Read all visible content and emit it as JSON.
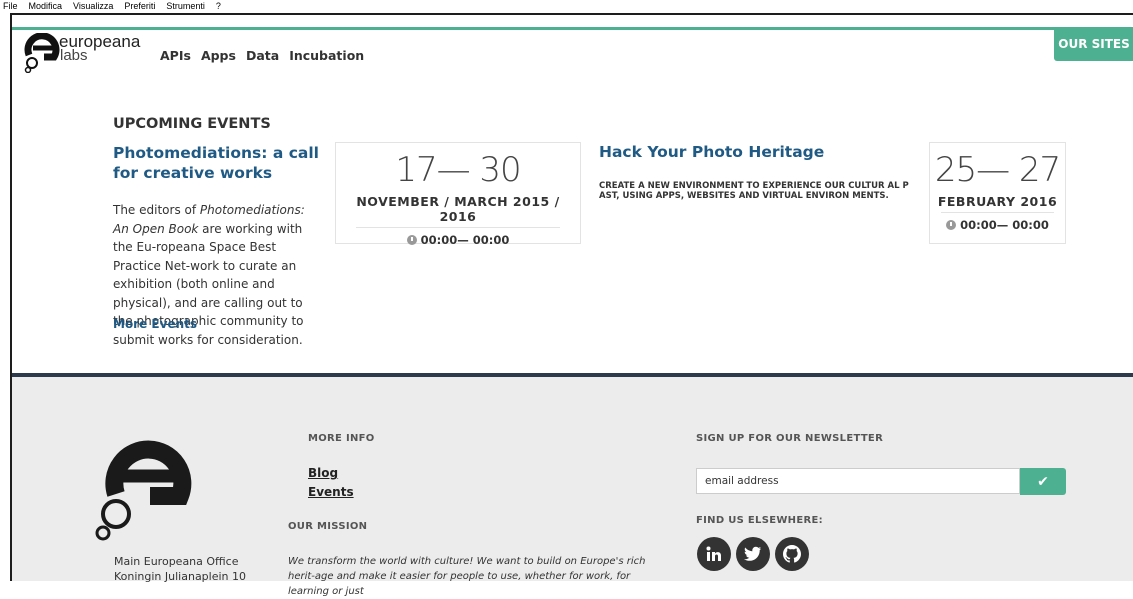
{
  "menubar": [
    "File",
    "Modifica",
    "Visualizza",
    "Preferiti",
    "Strumenti",
    "?"
  ],
  "header": {
    "brand_line1": "europeana",
    "brand_line2": "labs",
    "nav": [
      "APIs",
      "Apps",
      "Data",
      "Incubation"
    ],
    "our_sites": "OUR SITES"
  },
  "events": {
    "section_title": "UPCOMING EVENTS",
    "event1": {
      "title": "Photomediations: a call for creative works",
      "body_prefix": "The editors of ",
      "body_italic": "Photomediations: An Open Book",
      "body_rest": " are working with the Eu-ropeana Space Best Practice Net-work to curate an exhibition (both online and physical), and are calling out to the photographic community to submit works for consideration.",
      "date_range": "17— 30",
      "months": "NOVEMBER / MARCH 2015 / 2016",
      "time": "00:00— 00:00"
    },
    "event2": {
      "title": "Hack Your Photo Heritage",
      "description": "CREATE A NEW ENVIRONMENT TO EXPERIENCE OUR CULTUR AL PAST, USING APPS, WEBSITES AND VIRTUAL ENVIRON MENTS.",
      "date_range": "25— 27",
      "months": "FEBRUARY 2016",
      "time": "00:00— 00:00"
    },
    "more_events": "More Events"
  },
  "footer": {
    "office_line1": "Main Europeana Office",
    "office_line2": "Koningin Julianaplein 10",
    "more_info_heading": "MORE INFO",
    "links": [
      "Blog",
      "Events"
    ],
    "mission_heading": "OUR MISSION",
    "mission_text": "We transform the world with culture! We want to build on Europe's rich herit-age and make it easier for people to use, whether for work, for learning or just",
    "newsletter_heading": "SIGN UP FOR OUR NEWSLETTER",
    "email_placeholder": "email address",
    "elsewhere_heading": "FIND US ELSEWHERE:",
    "social": [
      "linkedin-icon",
      "twitter-icon",
      "github-icon"
    ]
  },
  "colors": {
    "accent": "#4db191",
    "link": "#1f5a85",
    "footer_bg": "#ececec",
    "divider": "#2c3a4b"
  }
}
